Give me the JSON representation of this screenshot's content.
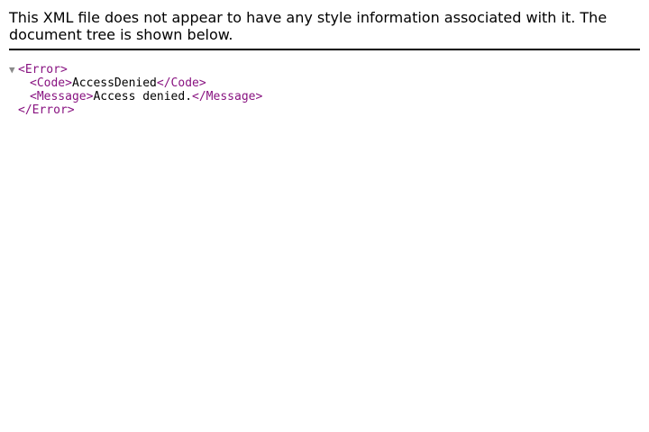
{
  "info_header": {
    "line1": "This XML file does not appear to have any style information associated with it. The",
    "line2": "document tree is shown below."
  },
  "tree": {
    "toggle_icon": "▼",
    "root_open": "<Error>",
    "root_close": "</Error>",
    "children": [
      {
        "open": "<Code>",
        "text": "AccessDenied",
        "close": "</Code>"
      },
      {
        "open": "<Message>",
        "text": "Access denied.",
        "close": "</Message>"
      }
    ]
  }
}
